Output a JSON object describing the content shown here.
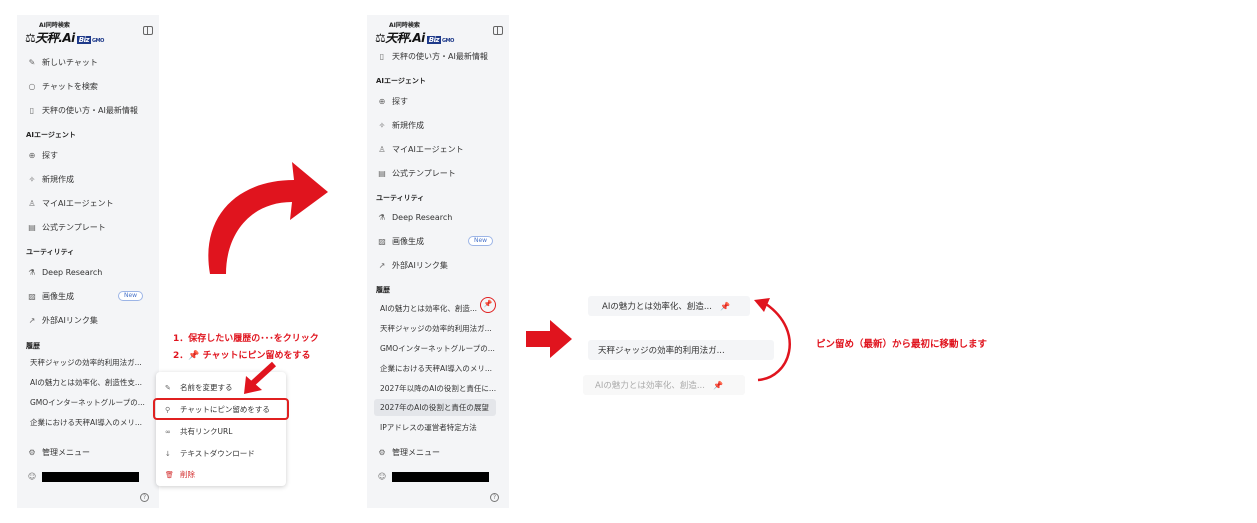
{
  "logo": {
    "top": "AI同時検索",
    "main": "天秤.Ai",
    "biz": "Biz",
    "gmo": "GMO"
  },
  "sidebar1": {
    "new_chat": "新しいチャット",
    "search_chat": "チャットを検索",
    "usage": "天秤の使い方・AI最新情報",
    "agent_section": "AIエージェント",
    "agent_items": [
      "探す",
      "新規作成",
      "マイAIエージェント",
      "公式テンプレート"
    ],
    "utility_section": "ユーティリティ",
    "utility_items": [
      "Deep Research",
      "画像生成",
      "外部AIリンク集"
    ],
    "new_badge": "New",
    "history_section": "履歴",
    "history": [
      "天秤ジャッジの効率的利用法ガ...",
      "AIの魅力とは効率化、創造性支...",
      "GMOインターネットグループの...",
      "企業における天秤AI導入のメリ..."
    ],
    "admin": "管理メニュー",
    "help": "?"
  },
  "context_menu": {
    "rename": "名前を変更する",
    "pin": "チャットにピン留めをする",
    "share": "共有リンクURL",
    "download": "テキストダウンロード",
    "delete": "削除"
  },
  "instructions": {
    "step1": "1．保存したい履歴の･･･をクリック",
    "step2_prefix": "2．",
    "step2": "チャットにピン留めをする"
  },
  "sidebar2": {
    "usage": "天秤の使い方・AI最新情報",
    "agent_section": "AIエージェント",
    "agent_items": [
      "探す",
      "新規作成",
      "マイAIエージェント",
      "公式テンプレート"
    ],
    "utility_section": "ユーティリティ",
    "utility_items": [
      "Deep Research",
      "画像生成",
      "外部AIリンク集"
    ],
    "new_badge": "New",
    "history_section": "履歴",
    "history": [
      "AIの魅力とは効率化、創造...",
      "天秤ジャッジの効率的利用法ガ...",
      "GMOインターネットグループの...",
      "企業における天秤AI導入のメリ...",
      "2027年以降のAIの役割と責任に...",
      "2027年のAIの役割と責任の展望",
      "IPアドレスの運営者特定方法"
    ],
    "admin": "管理メニュー",
    "help": "?"
  },
  "result": {
    "card_top": "AIの魅力とは効率化、創造...",
    "card_mid": "天秤ジャッジの効率的利用法ガ...",
    "card_bottom": "AIの魅力とは効率化、創造...",
    "caption": "ピン留め（最新）から最初に移動します"
  },
  "colors": {
    "accent_red": "#e0141e",
    "sidebar_bg": "#f4f5f7",
    "new_badge": "#4a74c9"
  }
}
